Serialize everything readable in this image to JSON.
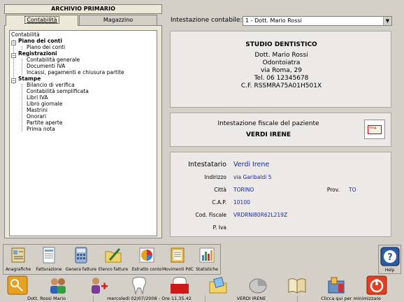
{
  "left_panel": {
    "title": "ARCHIVIO PRIMARIO",
    "tabs": [
      "Contabilità",
      "Magazzino"
    ],
    "tree": [
      {
        "label": "Contabilità",
        "level": 0,
        "bold": false
      },
      {
        "label": "Piano dei conti",
        "level": 1,
        "bold": true
      },
      {
        "label": "Piano dei conti",
        "level": 2,
        "bold": false
      },
      {
        "label": "Registrazioni",
        "level": 1,
        "bold": true
      },
      {
        "label": "Contabilità generale",
        "level": 2,
        "bold": false
      },
      {
        "label": "Documenti IVA",
        "level": 2,
        "bold": false
      },
      {
        "label": "Incassi, pagamenti e chiusura partite",
        "level": 2,
        "bold": false
      },
      {
        "label": "Stampe",
        "level": 1,
        "bold": true
      },
      {
        "label": "Bilancio di verifica",
        "level": 2,
        "bold": false
      },
      {
        "label": "Contabilità semplificata",
        "level": 2,
        "bold": false
      },
      {
        "label": "Libri IVA",
        "level": 2,
        "bold": false
      },
      {
        "label": "Libro giornale",
        "level": 2,
        "bold": false
      },
      {
        "label": "Mastrini",
        "level": 2,
        "bold": false
      },
      {
        "label": "Onorari",
        "level": 2,
        "bold": false
      },
      {
        "label": "Partite aperte",
        "level": 2,
        "bold": false
      },
      {
        "label": "Prima nota",
        "level": 2,
        "bold": false
      }
    ]
  },
  "header": {
    "intestazione_label": "Intestazione contabile:",
    "intestazione_value": "1 - Dott. Mario Rossi"
  },
  "studio": {
    "lines": [
      "STUDIO DENTISTICO",
      "Dott. Mario Rossi",
      "Odontoiatra",
      "via Roma, 29",
      "Tel. 06 12345678",
      "C.F. RSSMRA75A01H501X"
    ]
  },
  "fiscale": {
    "label": "Intestazione fiscale del paziente",
    "name": "VERDI IRENE",
    "icon_text": "Anag."
  },
  "paziente": {
    "intestatario_label": "Intestatario",
    "intestatario_value": "Verdi Irene",
    "indirizzo_label": "Indirizzo",
    "indirizzo_value": "via Garibaldi 5",
    "citta_label": "Città",
    "citta_value": "TORINO",
    "prov_label": "Prov.",
    "prov_value": "TO",
    "cap_label": "C.A.P.",
    "cap_value": "10100",
    "codfisc_label": "Cod. Fiscale",
    "codfisc_value": "VRDRNI80R62L219Z",
    "piva_label": "P. Iva"
  },
  "toolbar": {
    "buttons": [
      "Anagrafiche",
      "Fatturazione",
      "Genera fatture",
      "Elenco fatture",
      "Estratto conto",
      "Movimenti PdC",
      "Statistiche"
    ],
    "help": "Help"
  },
  "status_bar": {
    "user": "Dott. Rossi Mario",
    "datetime": "mercoledì 02/07/2008 - Ore 11.35.42",
    "patient": "VERDI IRENE",
    "minimize": "Clicca qui per minimizzare"
  },
  "colors": {
    "value_blue": "#1a2a9a",
    "window_bg": "#d4d0c8"
  }
}
